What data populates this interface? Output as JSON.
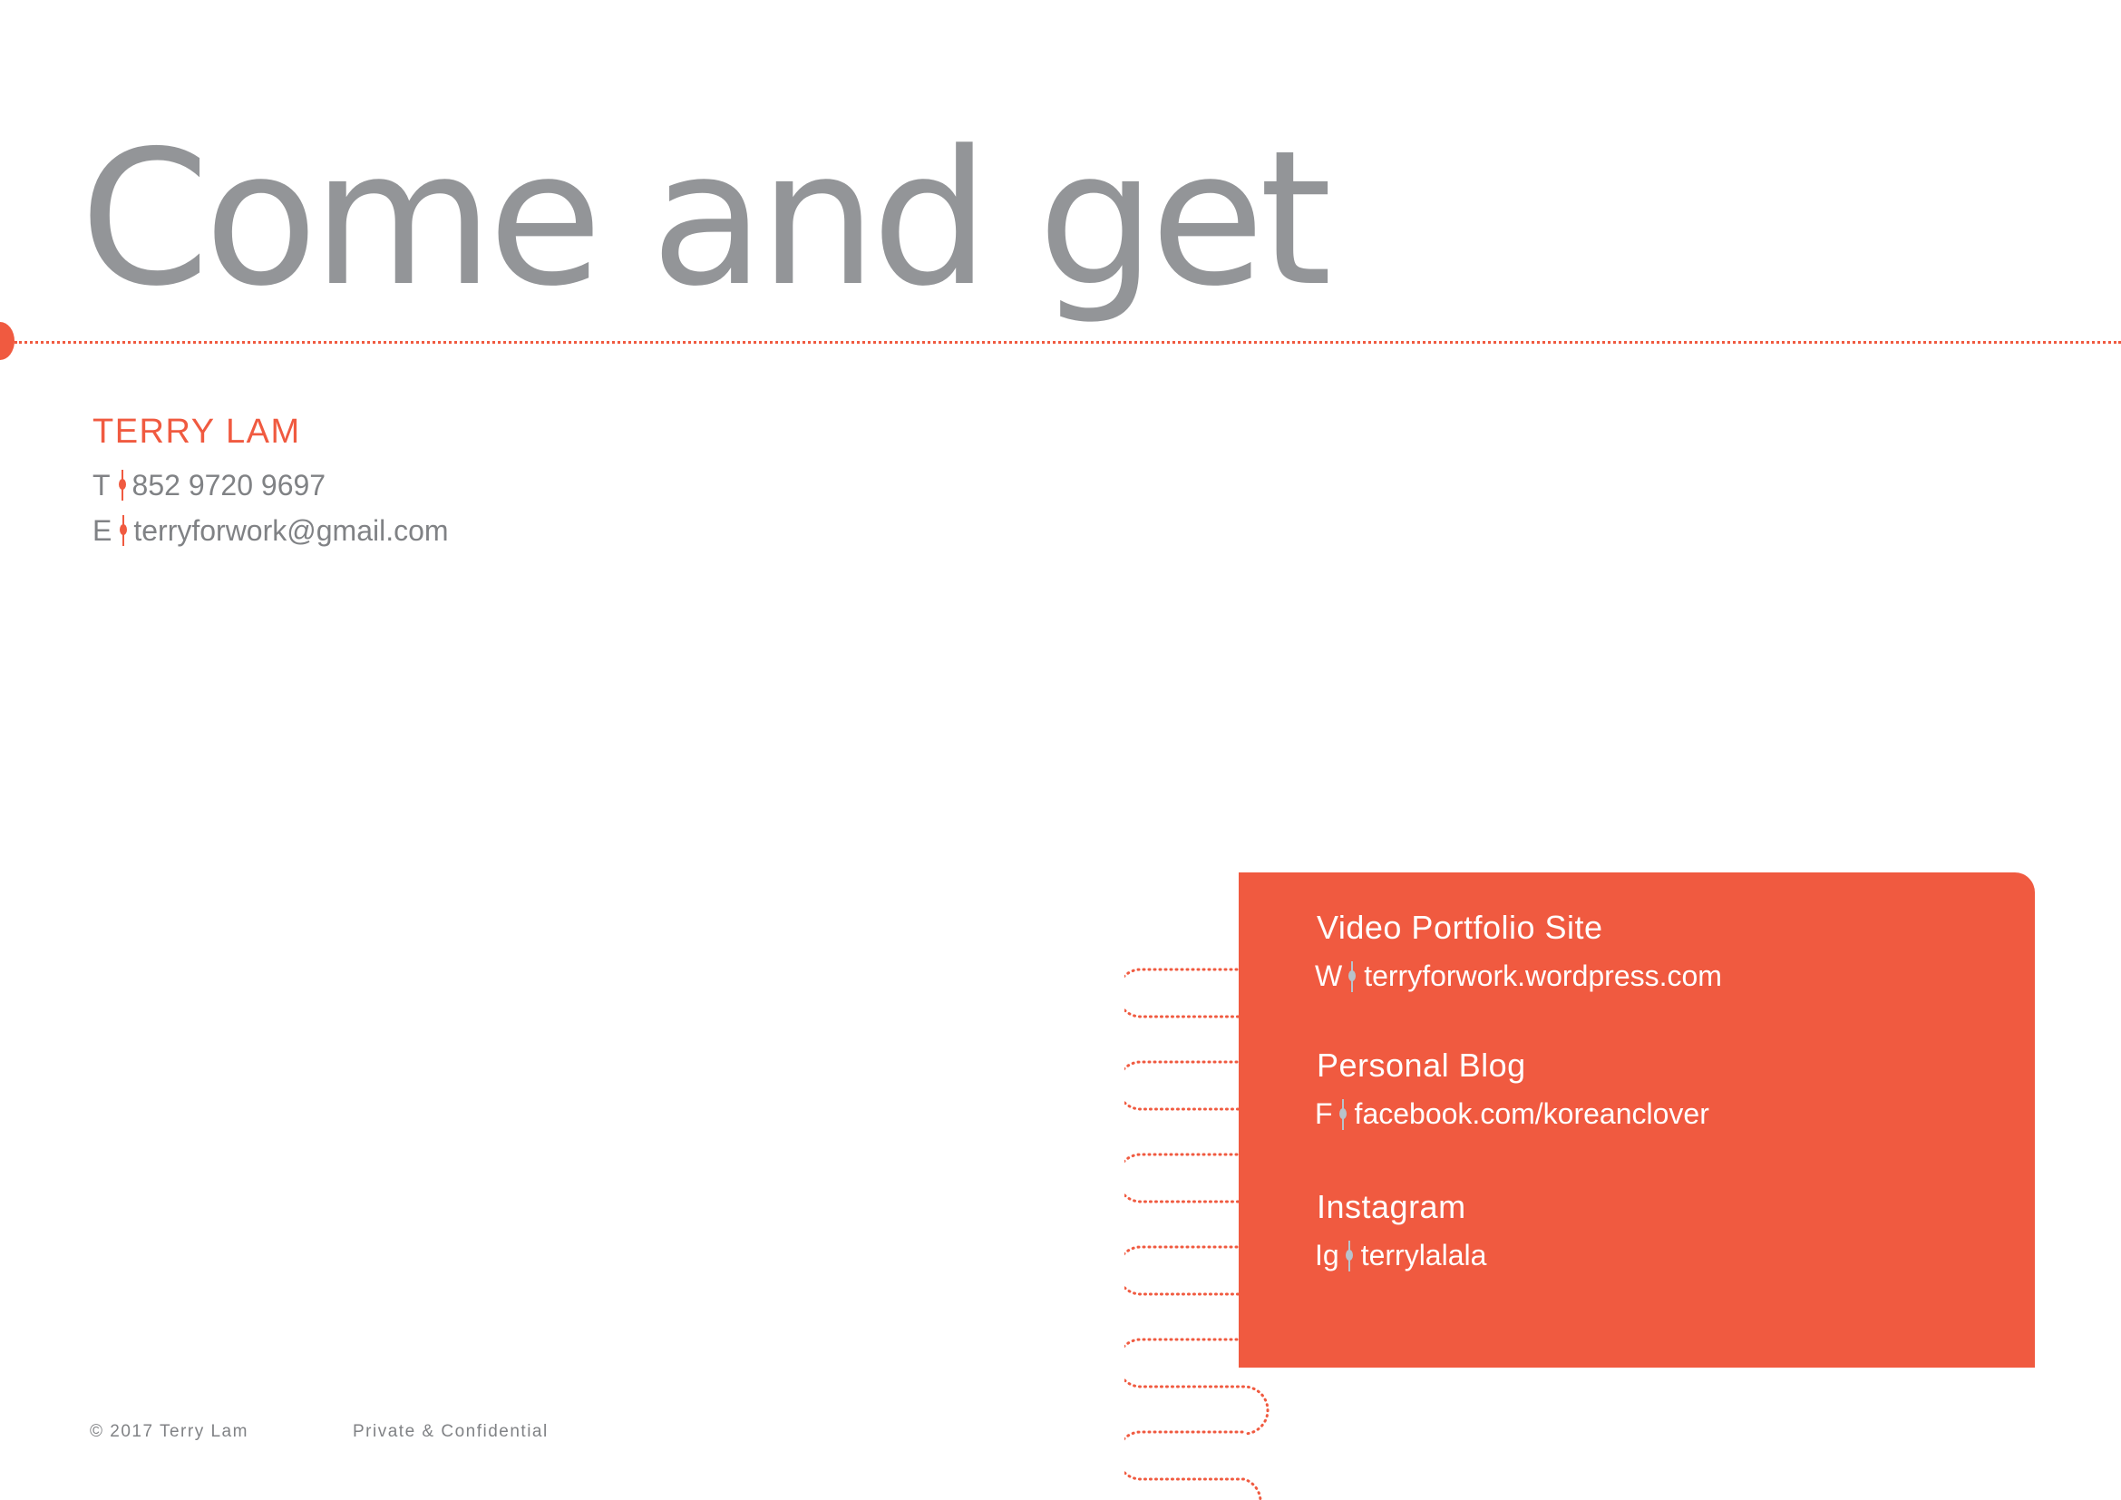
{
  "heading": "Come and get",
  "contact": {
    "name": "TERRY LAM",
    "phone_prefix": "T",
    "phone": "852 9720 9697",
    "email_prefix": "E",
    "email": "terryforwork@gmail.com"
  },
  "links_card": {
    "video": {
      "title": "Video Portfolio Site",
      "prefix": "W",
      "value": "terryforwork.wordpress.com"
    },
    "blog": {
      "title": "Personal Blog",
      "prefix": "F",
      "value": "facebook.com/koreanclover"
    },
    "instagram": {
      "title": "Instagram",
      "prefix": "Ig",
      "value": "terrylalala"
    }
  },
  "footer": {
    "copyright": "© 2017 Terry Lam",
    "confidential": "Private & Confidential"
  },
  "colors": {
    "accent": "#f05a40",
    "heading": "#939598",
    "body_text": "#808285",
    "card_text": "#ffffff",
    "separator_on_card": "#b7c3cc"
  },
  "icons": {
    "separator": "pin-separator-icon",
    "binding": "spiral-binding-icon",
    "timeline": "timeline-dot-icon"
  }
}
